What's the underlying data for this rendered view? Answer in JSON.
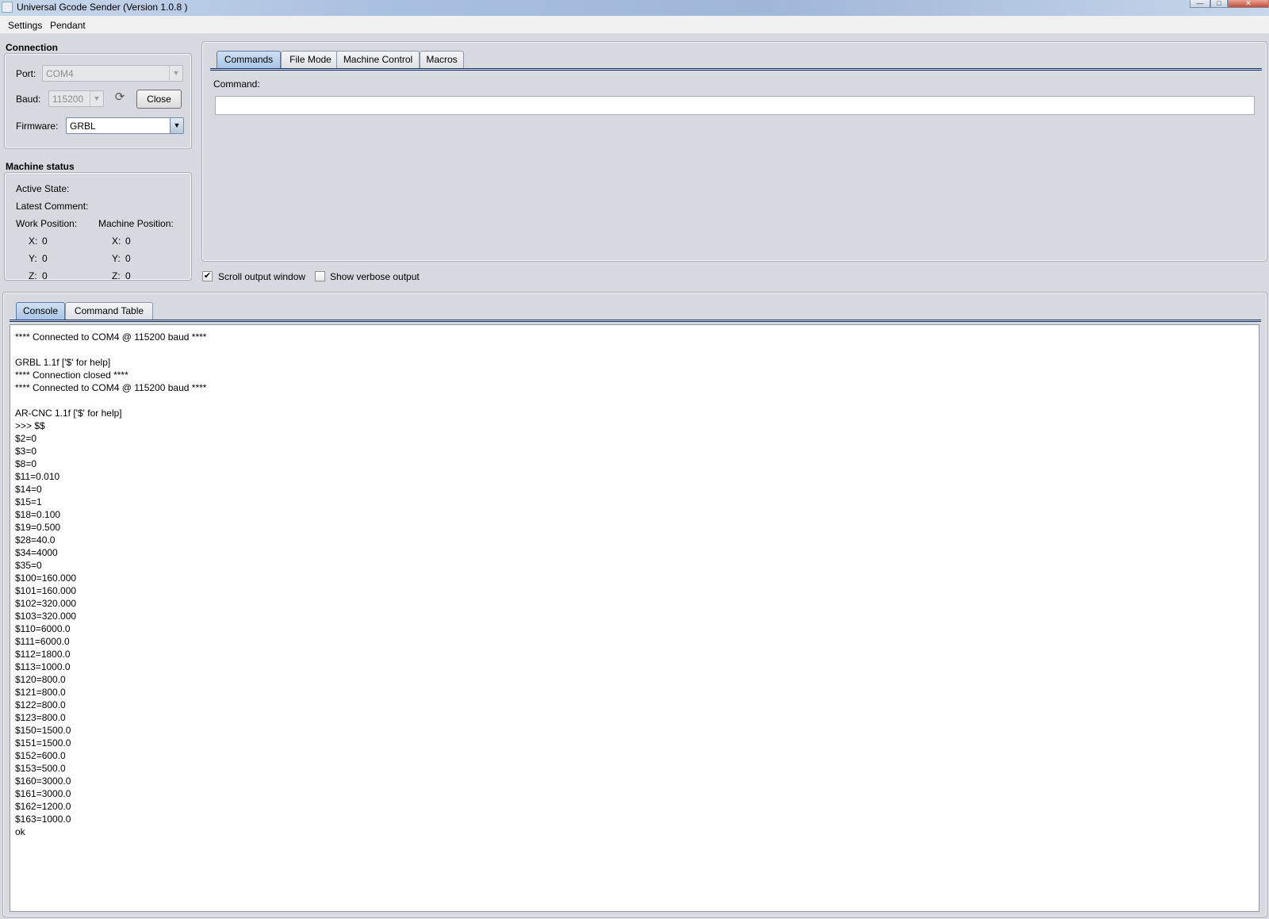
{
  "window": {
    "title": "Universal Gcode Sender (Version 1.0.8 )"
  },
  "menu": {
    "items": [
      "Settings",
      "Pendant"
    ]
  },
  "connection": {
    "group_label": "Connection",
    "port_label": "Port:",
    "port_value": "COM4",
    "baud_label": "Baud:",
    "baud_value": "115200",
    "close_button": "Close",
    "firmware_label": "Firmware:",
    "firmware_value": "GRBL"
  },
  "machine_status": {
    "group_label": "Machine status",
    "active_state_label": "Active State:",
    "latest_comment_label": "Latest Comment:",
    "work_position_label": "Work Position:",
    "machine_position_label": "Machine Position:",
    "work": {
      "x_label": "X:",
      "x": "0",
      "y_label": "Y:",
      "y": "0",
      "z_label": "Z:",
      "z": "0"
    },
    "machine": {
      "x_label": "X:",
      "x": "0",
      "y_label": "Y:",
      "y": "0",
      "z_label": "Z:",
      "z": "0"
    }
  },
  "top_tabs": {
    "items": [
      "Commands",
      "File Mode",
      "Machine Control",
      "Macros"
    ],
    "active": "Commands"
  },
  "commands": {
    "command_label": "Command:",
    "command_value": ""
  },
  "options": {
    "scroll_output_label": "Scroll output window",
    "scroll_output_checked": true,
    "verbose_label": "Show verbose output",
    "verbose_checked": false
  },
  "bottom_tabs": {
    "items": [
      "Console",
      "Command Table"
    ],
    "active": "Console"
  },
  "console": {
    "lines": [
      "**** Connected to COM4 @ 115200 baud ****",
      "",
      "GRBL 1.1f ['$' for help]",
      "**** Connection closed ****",
      "**** Connected to COM4 @ 115200 baud ****",
      "",
      "AR-CNC 1.1f ['$' for help]",
      ">>> $$",
      "$2=0",
      "$3=0",
      "$8=0",
      "$11=0.010",
      "$14=0",
      "$15=1",
      "$18=0.100",
      "$19=0.500",
      "$28=40.0",
      "$34=4000",
      "$35=0",
      "$100=160.000",
      "$101=160.000",
      "$102=320.000",
      "$103=320.000",
      "$110=6000.0",
      "$111=6000.0",
      "$112=1800.0",
      "$113=1000.0",
      "$120=800.0",
      "$121=800.0",
      "$122=800.0",
      "$123=800.0",
      "$150=1500.0",
      "$151=1500.0",
      "$152=600.0",
      "$153=500.0",
      "$160=3000.0",
      "$161=3000.0",
      "$162=1200.0",
      "$163=1000.0",
      "ok"
    ]
  }
}
